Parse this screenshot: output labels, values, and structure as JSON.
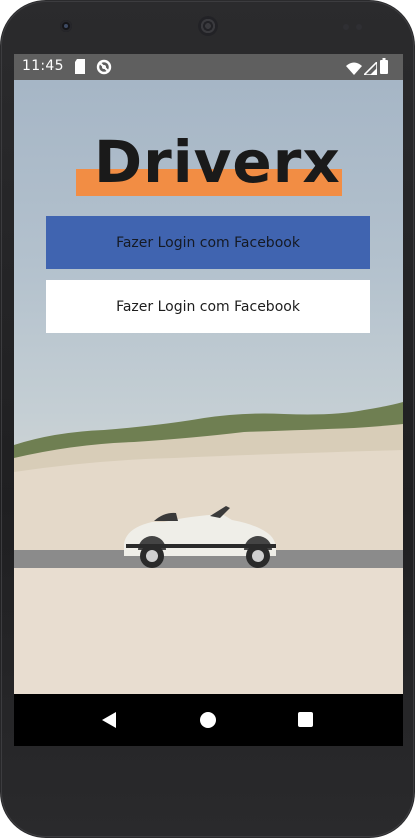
{
  "status_bar": {
    "time": "11:45",
    "icons": [
      "sd-card-icon",
      "sync-icon",
      "wifi-icon",
      "signal-icon",
      "battery-icon"
    ]
  },
  "app": {
    "logo_text": "Driverx",
    "accent_color": "#f28d44",
    "buttons": {
      "facebook_login_label": "Fazer Login com Facebook",
      "facebook_login_color": "#4064b0",
      "second_login_label": "Fazer Login com Facebook",
      "second_login_color": "#ffffff"
    }
  },
  "nav_bar": {
    "icons": [
      "back-icon",
      "home-icon",
      "recents-icon"
    ]
  }
}
